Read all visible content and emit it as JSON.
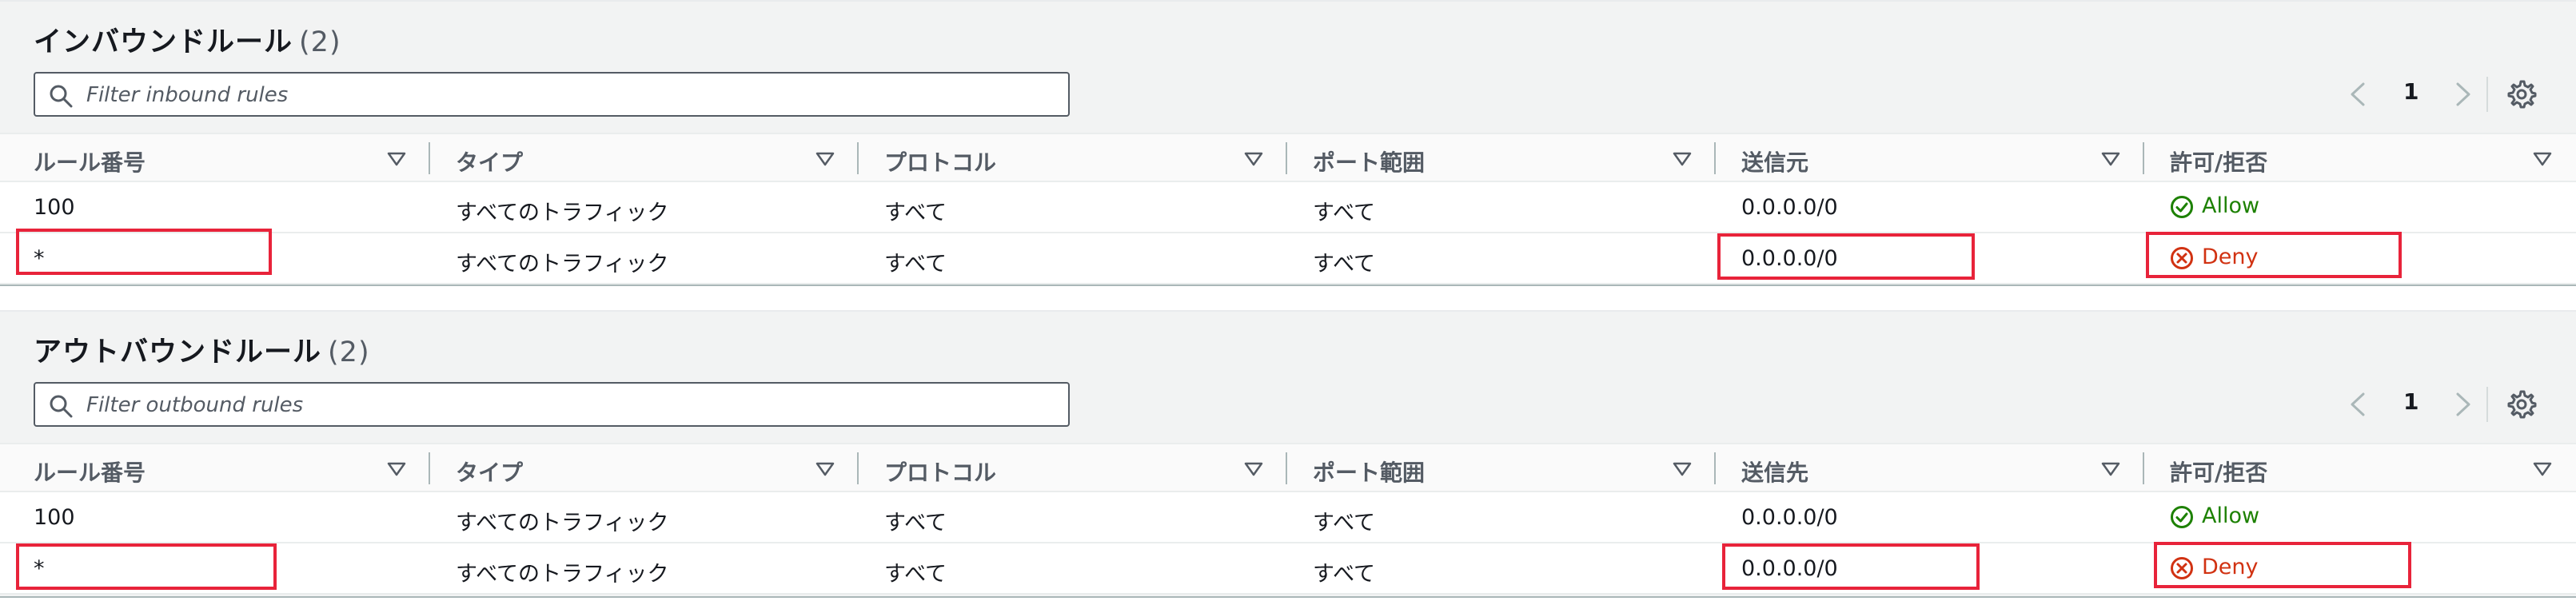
{
  "inbound": {
    "title": "インバウンドルール",
    "count": "(2)",
    "search_placeholder": "Filter inbound rules",
    "page": "1",
    "columns": [
      "ルール番号",
      "タイプ",
      "プロトコル",
      "ポート範囲",
      "送信元",
      "許可/拒否"
    ],
    "rows": [
      {
        "rule": "100",
        "type": "すべてのトラフィック",
        "protocol": "すべて",
        "port": "すべて",
        "cidr": "0.0.0.0/0",
        "action": "Allow"
      },
      {
        "rule": "*",
        "type": "すべてのトラフィック",
        "protocol": "すべて",
        "port": "すべて",
        "cidr": "0.0.0.0/0",
        "action": "Deny"
      }
    ]
  },
  "outbound": {
    "title": "アウトバウンドルール",
    "count": "(2)",
    "search_placeholder": "Filter outbound rules",
    "page": "1",
    "columns": [
      "ルール番号",
      "タイプ",
      "プロトコル",
      "ポート範囲",
      "送信先",
      "許可/拒否"
    ],
    "rows": [
      {
        "rule": "100",
        "type": "すべてのトラフィック",
        "protocol": "すべて",
        "port": "すべて",
        "cidr": "0.0.0.0/0",
        "action": "Allow"
      },
      {
        "rule": "*",
        "type": "すべてのトラフィック",
        "protocol": "すべて",
        "port": "すべて",
        "cidr": "0.0.0.0/0",
        "action": "Deny"
      }
    ]
  },
  "colors": {
    "allow": "#1d8102",
    "deny": "#d13212",
    "highlight": "#e8233a"
  },
  "icons": {
    "search": "search-icon",
    "prev": "chevron-left-icon",
    "next": "chevron-right-icon",
    "settings": "gear-icon",
    "sort": "sort-caret-icon",
    "allow": "check-circle-icon",
    "deny": "x-circle-icon"
  }
}
